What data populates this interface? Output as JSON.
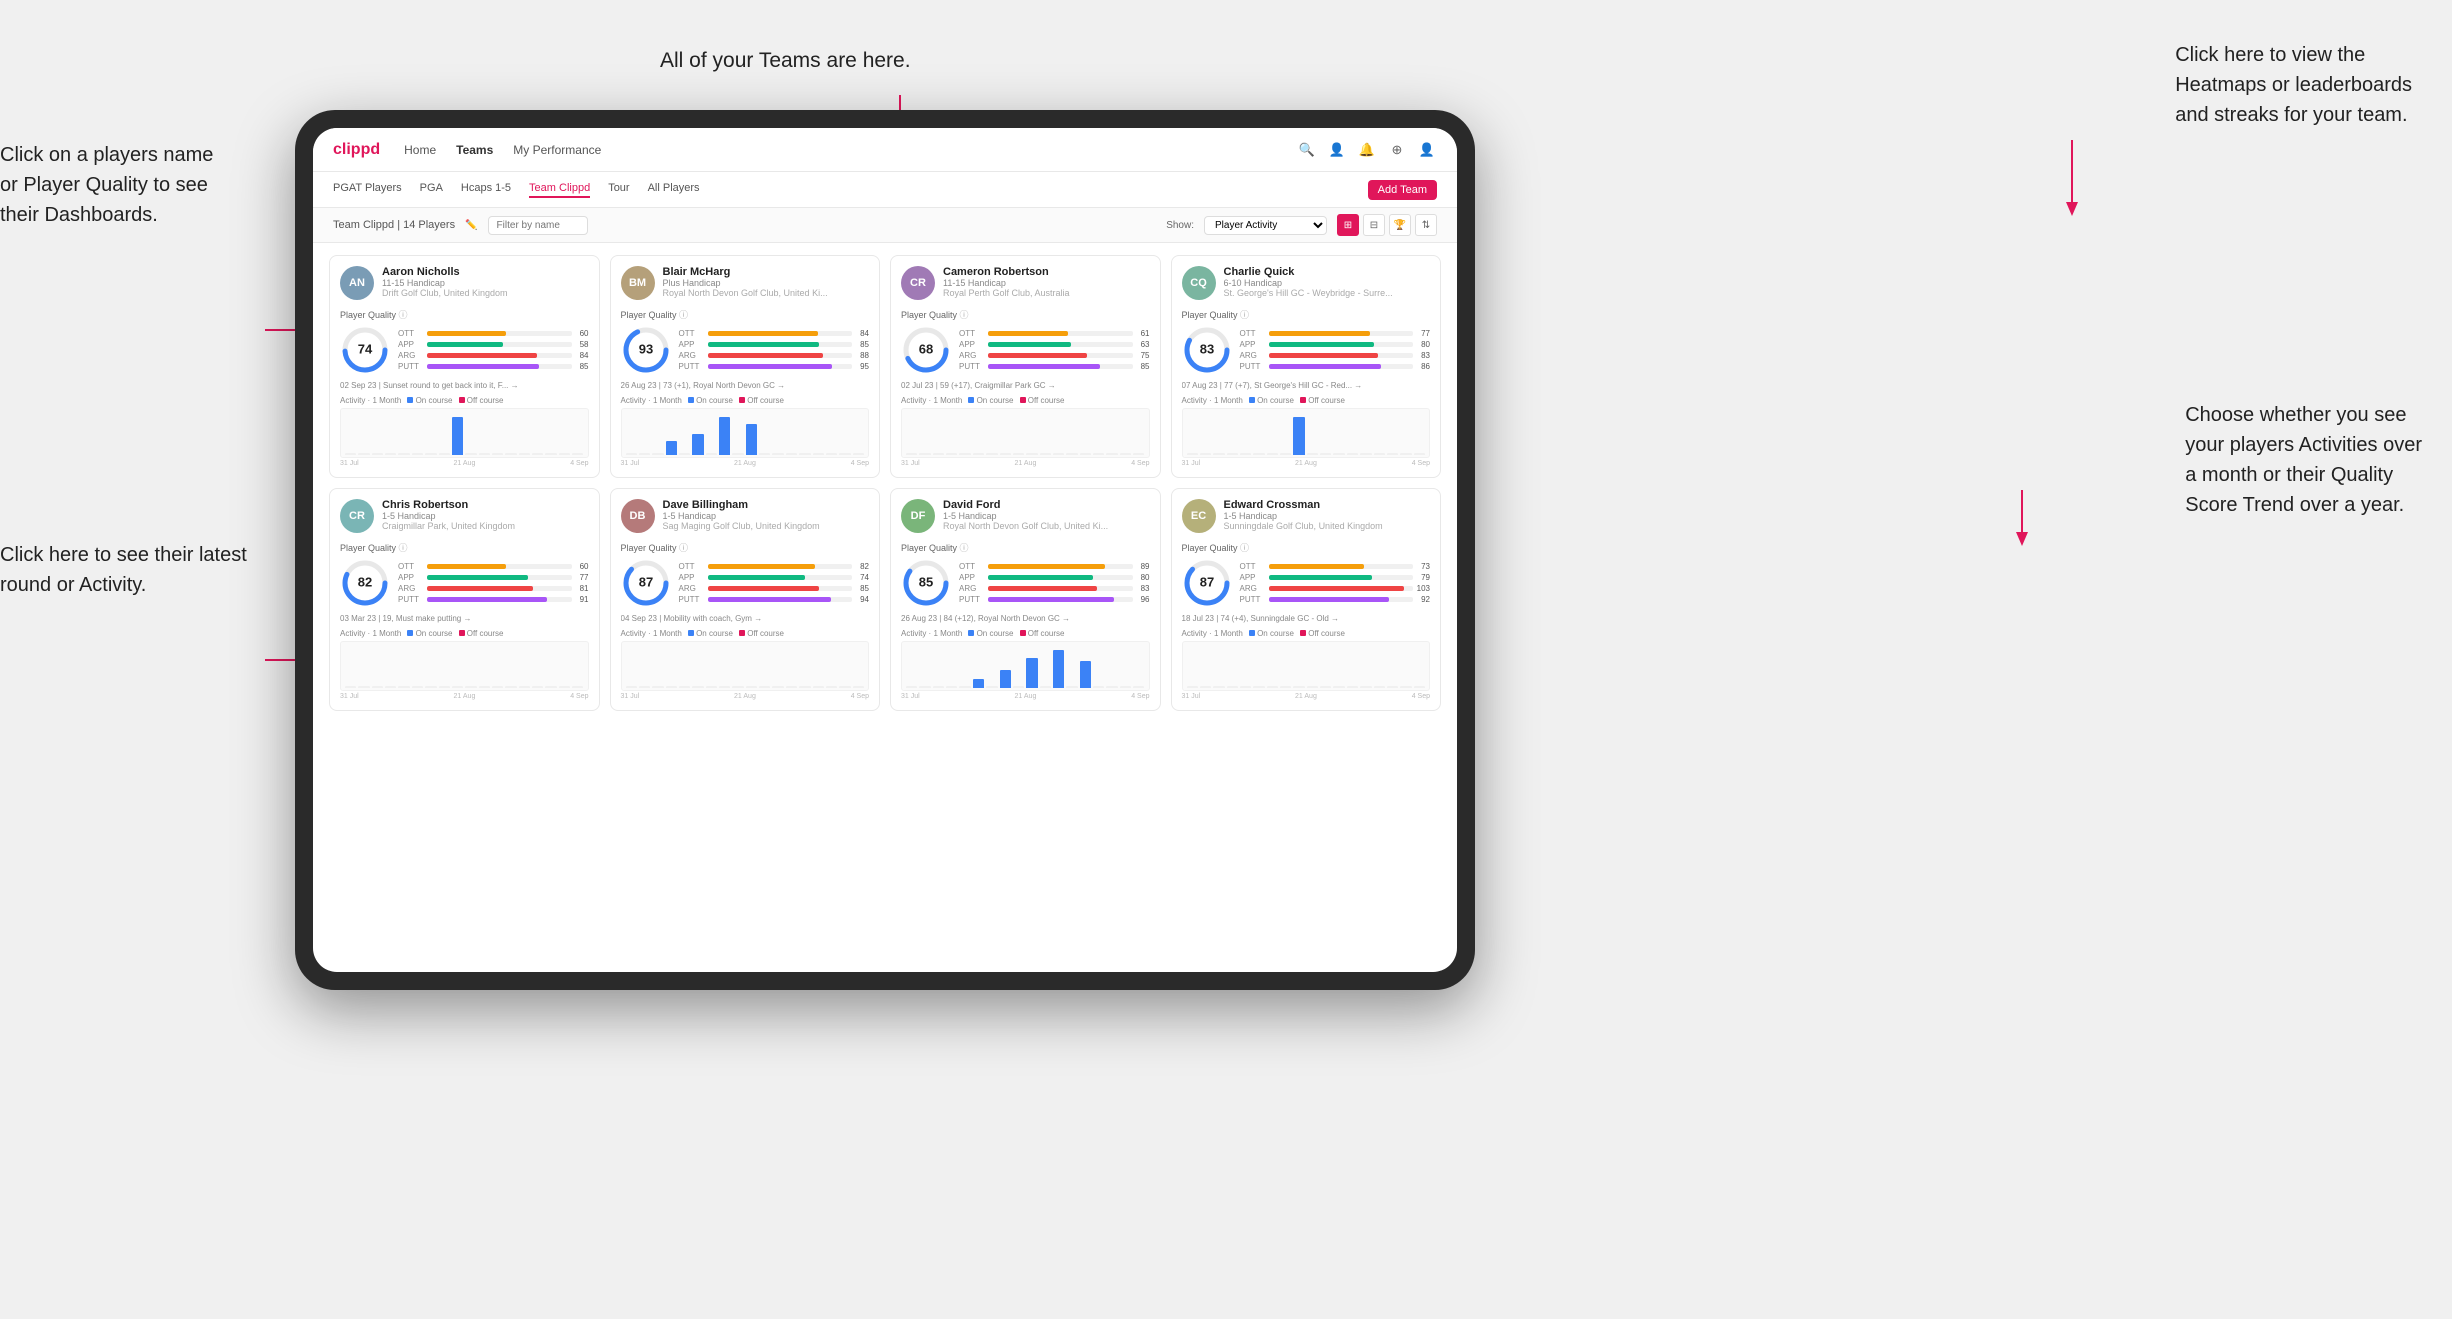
{
  "annotations": {
    "teams_note": "All of your Teams are here.",
    "heatmaps_note": "Click here to view the\nHeatmaps or leaderboards\nand streaks for your team.",
    "player_name_note": "Click on a players name\nor Player Quality to see\ntheir Dashboards.",
    "latest_round_note": "Click here to see their latest\nround or Activity.",
    "activity_note": "Choose whether you see\nyour players Activities over\na month or their Quality\nScore Trend over a year."
  },
  "nav": {
    "logo": "clippd",
    "items": [
      "Home",
      "Teams",
      "My Performance"
    ],
    "icons": [
      "🔍",
      "👤",
      "🔔",
      "⊕",
      "👤"
    ]
  },
  "sub_nav": {
    "items": [
      "PGAT Players",
      "PGA",
      "Hcaps 1-5",
      "Team Clippd",
      "Tour",
      "All Players"
    ],
    "active": "Team Clippd",
    "add_btn": "Add Team"
  },
  "filter_bar": {
    "label": "Team Clippd | 14 Players",
    "placeholder": "Filter by name",
    "show_label": "Show:",
    "show_value": "Player Activity",
    "view_options": [
      "grid-2",
      "grid-4",
      "trophy",
      "sort"
    ]
  },
  "players": [
    {
      "name": "Aaron Nicholls",
      "handicap": "11-15 Handicap",
      "club": "Drift Golf Club, United Kingdom",
      "quality": 74,
      "ott": 60,
      "app": 58,
      "arg": 84,
      "putt": 85,
      "last_round": "02 Sep 23 | Sunset round to get back into it, F... →",
      "bars": [
        0,
        0,
        0,
        0,
        0,
        0,
        0,
        0,
        12,
        0,
        0,
        0,
        0,
        0,
        0,
        0,
        0,
        0
      ],
      "color": "#3b82f6"
    },
    {
      "name": "Blair McHarg",
      "handicap": "Plus Handicap",
      "club": "Royal North Devon Golf Club, United Ki...",
      "quality": 93,
      "ott": 84,
      "app": 85,
      "arg": 88,
      "putt": 95,
      "last_round": "26 Aug 23 | 73 (+1), Royal North Devon GC →",
      "bars": [
        0,
        0,
        0,
        8,
        0,
        12,
        0,
        22,
        0,
        18,
        0,
        0,
        0,
        0,
        0,
        0,
        0,
        0
      ],
      "color": "#3b82f6"
    },
    {
      "name": "Cameron Robertson",
      "handicap": "11-15 Handicap",
      "club": "Royal Perth Golf Club, Australia",
      "quality": 68,
      "ott": 61,
      "app": 63,
      "arg": 75,
      "putt": 85,
      "last_round": "02 Jul 23 | 59 (+17), Craigmillar Park GC →",
      "bars": [
        0,
        0,
        0,
        0,
        0,
        0,
        0,
        0,
        0,
        0,
        0,
        0,
        0,
        0,
        0,
        0,
        0,
        0
      ],
      "color": "#3b82f6"
    },
    {
      "name": "Charlie Quick",
      "handicap": "6-10 Handicap",
      "club": "St. George's Hill GC - Weybridge - Surre...",
      "quality": 83,
      "ott": 77,
      "app": 80,
      "arg": 83,
      "putt": 86,
      "last_round": "07 Aug 23 | 77 (+7), St George's Hill GC - Red... →",
      "bars": [
        0,
        0,
        0,
        0,
        0,
        0,
        0,
        0,
        10,
        0,
        0,
        0,
        0,
        0,
        0,
        0,
        0,
        0
      ],
      "color": "#3b82f6"
    },
    {
      "name": "Chris Robertson",
      "handicap": "1-5 Handicap",
      "club": "Craigmillar Park, United Kingdom",
      "quality": 82,
      "ott": 60,
      "app": 77,
      "arg": 81,
      "putt": 91,
      "last_round": "03 Mar 23 | 19, Must make putting →",
      "bars": [
        0,
        0,
        0,
        0,
        0,
        0,
        0,
        0,
        0,
        0,
        0,
        0,
        0,
        0,
        0,
        0,
        0,
        0
      ],
      "color": "#3b82f6"
    },
    {
      "name": "Dave Billingham",
      "handicap": "1-5 Handicap",
      "club": "Sag Maging Golf Club, United Kingdom",
      "quality": 87,
      "ott": 82,
      "app": 74,
      "arg": 85,
      "putt": 94,
      "last_round": "04 Sep 23 | Mobility with coach, Gym →",
      "bars": [
        0,
        0,
        0,
        0,
        0,
        0,
        0,
        0,
        0,
        0,
        0,
        0,
        0,
        0,
        0,
        0,
        0,
        0
      ],
      "color": "#3b82f6"
    },
    {
      "name": "David Ford",
      "handicap": "1-5 Handicap",
      "club": "Royal North Devon Golf Club, United Ki...",
      "quality": 85,
      "ott": 89,
      "app": 80,
      "arg": 83,
      "putt": 96,
      "last_round": "26 Aug 23 | 84 (+12), Royal North Devon GC →",
      "bars": [
        0,
        0,
        0,
        0,
        0,
        6,
        0,
        12,
        0,
        20,
        0,
        25,
        0,
        18,
        0,
        0,
        0,
        0
      ],
      "color": "#3b82f6"
    },
    {
      "name": "Edward Crossman",
      "handicap": "1-5 Handicap",
      "club": "Sunningdale Golf Club, United Kingdom",
      "quality": 87,
      "ott": 73,
      "app": 79,
      "arg": 103,
      "putt": 92,
      "last_round": "18 Jul 23 | 74 (+4), Sunningdale GC - Old →",
      "bars": [
        0,
        0,
        0,
        0,
        0,
        0,
        0,
        0,
        0,
        0,
        0,
        0,
        0,
        0,
        0,
        0,
        0,
        0
      ],
      "color": "#3b82f6"
    }
  ],
  "stat_colors": {
    "ott": "#f59e0b",
    "app": "#10b981",
    "arg": "#ef4444",
    "putt": "#a855f7"
  },
  "chart_dates": [
    "31 Jul",
    "21 Aug",
    "4 Sep"
  ]
}
